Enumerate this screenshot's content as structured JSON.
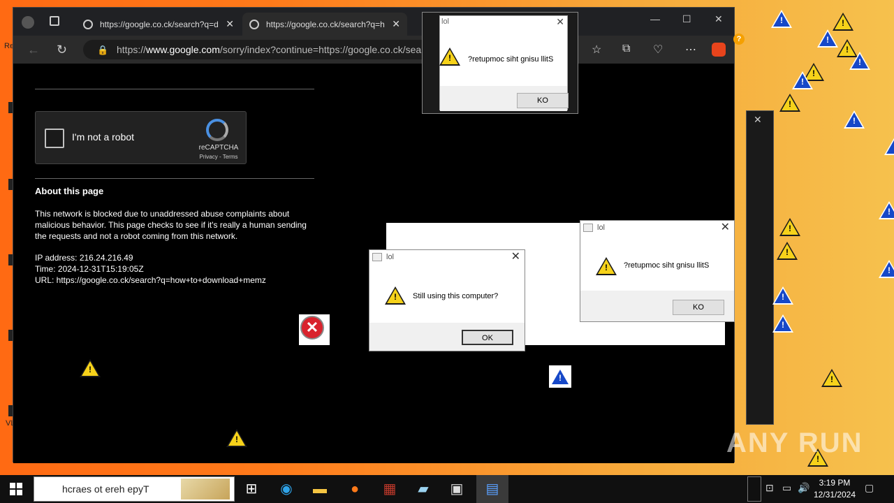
{
  "browser": {
    "tabs": [
      {
        "label": "https://google.co.ck/search?q=d",
        "active": false
      },
      {
        "label": "https://google.co.ck/search?q=h",
        "active": true
      }
    ],
    "url_prefix": "https://",
    "url_domain": "www.google.com",
    "url_rest": "/sorry/index?continue=https://google.co.ck/sear"
  },
  "captcha": {
    "label": "I'm not a robot",
    "brand": "reCAPTCHA",
    "terms": "Privacy - Terms"
  },
  "about": {
    "title": "About this page",
    "text": "This network is blocked due to unaddressed abuse complaints about malicious behavior. This page checks to see if it's really a human sending the requests and not a robot coming from this network.",
    "ip": "IP address: 216.24.216.49",
    "time": "Time: 2024-12-31T15:19:05Z",
    "url": "URL: https://google.co.ck/search?q=how+to+download+memz"
  },
  "dialogs": {
    "d1": {
      "title": "lol",
      "message": "?retupmoc siht gnisu llitS",
      "button": "KO"
    },
    "d2": {
      "title": "lol",
      "message": "?retupmoc siht gnisu llitS",
      "button": "KO"
    },
    "d3": {
      "title": "lol",
      "message": "Still using this computer?",
      "button": "OK"
    }
  },
  "taskbar": {
    "search_placeholder": "hcraes ot ereh epyT",
    "time": "3:19 PM",
    "date": "12/31/2024"
  },
  "watermark": "ANY RUN",
  "desktop": {
    "label_re": "Re",
    "label_vl": "VL",
    "question": "?"
  }
}
